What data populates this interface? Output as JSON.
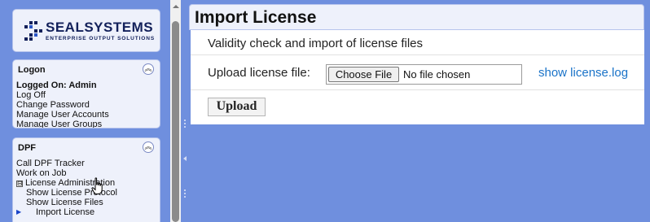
{
  "brand": {
    "name": "SEALSYSTEMS",
    "tagline": "ENTERPRISE OUTPUT SOLUTIONS",
    "icon": "seal-logo-icon",
    "color": "#12205a"
  },
  "sidebar": {
    "logon": {
      "title": "Logon",
      "collapse_icon": "double-chevron-up-icon",
      "items": [
        {
          "label": "Logged On: Admin"
        },
        {
          "label": "Log Off"
        },
        {
          "label": "Change Password"
        },
        {
          "label": "Manage User Accounts"
        },
        {
          "label": "Manage User Groups"
        }
      ]
    },
    "dpf": {
      "title": "DPF",
      "collapse_icon": "double-chevron-up-icon",
      "items": [
        {
          "label": "Call DPF Tracker"
        },
        {
          "label": "Work on Job"
        },
        {
          "label": "License Administration",
          "toggle": "⊟"
        },
        {
          "label": "Show License Protocol"
        },
        {
          "label": "Show License Files"
        },
        {
          "label": "Import License",
          "current_marker": "▶"
        }
      ]
    }
  },
  "main": {
    "title": "Import License",
    "description": "Validity check and import of license files",
    "upload_label": "Upload license file:",
    "choose_file_button": "Choose File",
    "no_file_text": "No file chosen",
    "log_link": "show license.log",
    "upload_button": "Upload"
  },
  "colors": {
    "background": "#6f8fde",
    "panel": "#eef1fb",
    "link": "#1a73c8"
  }
}
